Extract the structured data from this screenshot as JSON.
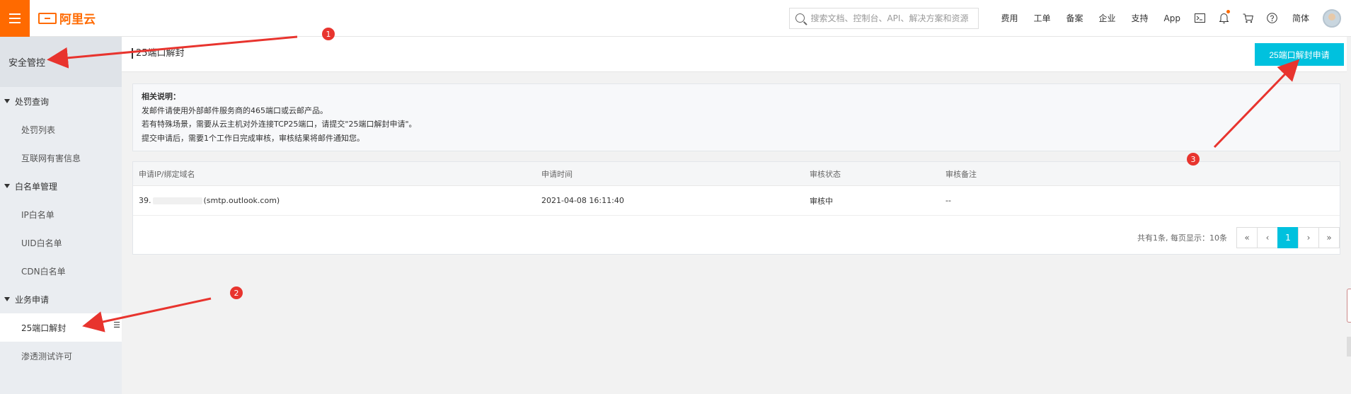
{
  "topbar": {
    "logo_text": "阿里云",
    "search_placeholder": "搜索文档、控制台、API、解决方案和资源",
    "nav": [
      "费用",
      "工单",
      "备案",
      "企业",
      "支持",
      "App"
    ],
    "lang": "简体"
  },
  "sidebar": {
    "title": "安全管控",
    "groups": [
      {
        "label": "处罚查询",
        "items": [
          "处罚列表",
          "互联网有害信息"
        ]
      },
      {
        "label": "白名单管理",
        "items": [
          "IP白名单",
          "UID白名单",
          "CDN白名单"
        ]
      },
      {
        "label": "业务申请",
        "items": [
          "25端口解封",
          "渗透测试许可"
        ]
      }
    ]
  },
  "page": {
    "title": "25端口解封",
    "apply_button": "25端口解封申请"
  },
  "notice": {
    "title": "相关说明：",
    "lines": [
      "发邮件请使用外部邮件服务商的465端口或云邮产品。",
      "若有特殊场景，需要从云主机对外连接TCP25端口，请提交\"25端口解封申请\"。",
      "提交申请后，需要1个工作日完成审核，审核结果将邮件通知您。"
    ]
  },
  "table": {
    "headers": [
      "申请IP/绑定域名",
      "申请时间",
      "审核状态",
      "审核备注"
    ],
    "rows": [
      {
        "ip_prefix": "39.",
        "domain": "(smtp.outlook.com)",
        "time": "2021-04-08 16:11:40",
        "status": "审核中",
        "note": "--"
      }
    ]
  },
  "pagination": {
    "info": "共有1条, 每页显示：10条",
    "first": "«",
    "prev": "‹",
    "current": "1",
    "next": "›",
    "last": "»"
  },
  "annotations": [
    "1",
    "2",
    "3"
  ],
  "colors": {
    "brand": "#ff6a00",
    "accent": "#00c1de",
    "annotation": "#e8342e"
  }
}
